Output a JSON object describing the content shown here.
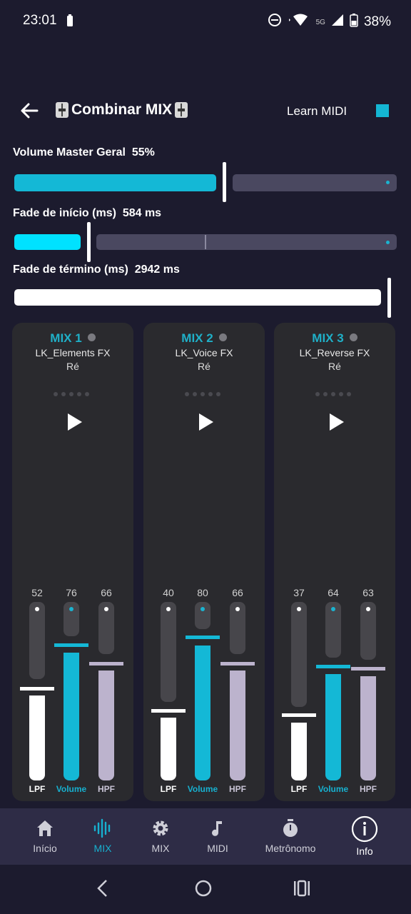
{
  "status": {
    "time": "23:01",
    "network": "5G",
    "battery": "38%"
  },
  "appbar": {
    "title": "Combinar MIX",
    "learn_midi": "Learn MIDI"
  },
  "controls": {
    "master": {
      "label": "Volume Master Geral",
      "value": "55%",
      "fraction": 0.55
    },
    "fade_in": {
      "label": "Fade de início (ms)",
      "value": "584 ms"
    },
    "fade_out": {
      "label": "Fade de término (ms)",
      "value": "2942 ms"
    }
  },
  "mixes": [
    {
      "title": "MIX 1",
      "name": "LK_Elements FX",
      "key": "Ré",
      "lpf": "52",
      "volume": "76",
      "hpf": "66"
    },
    {
      "title": "MIX 2",
      "name": "LK_Voice FX",
      "key": "Ré",
      "lpf": "40",
      "volume": "80",
      "hpf": "66"
    },
    {
      "title": "MIX 3",
      "name": "LK_Reverse FX",
      "key": "Ré",
      "lpf": "37",
      "volume": "64",
      "hpf": "63"
    }
  ],
  "fader_labels": {
    "lpf": "LPF",
    "volume": "Volume",
    "hpf": "HPF"
  },
  "nav": [
    {
      "label": "Início",
      "icon": "home-icon"
    },
    {
      "label": "MIX",
      "icon": "waveform-icon",
      "active": true
    },
    {
      "label": "MIX",
      "icon": "gear-icon"
    },
    {
      "label": "MIDI",
      "icon": "music-note-icon"
    },
    {
      "label": "Metrônomo",
      "icon": "timer-icon"
    },
    {
      "label": "Info",
      "icon": "info-icon"
    }
  ],
  "colors": {
    "accent": "#17b0cf",
    "background": "#1c1b2e",
    "card": "#2a2a2e",
    "hpf": "#bcb3cd"
  }
}
